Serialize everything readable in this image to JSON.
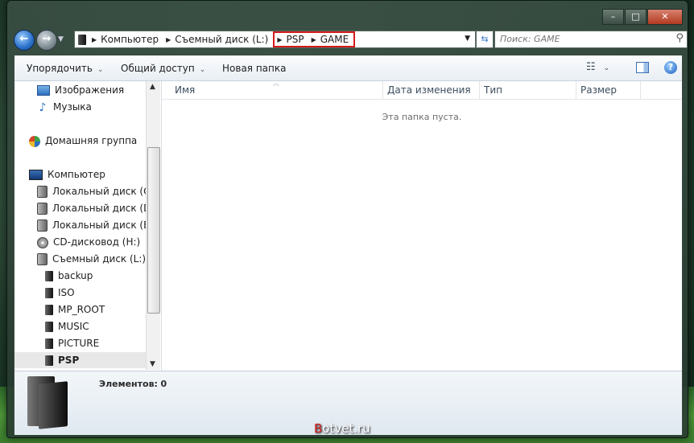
{
  "window": {
    "minimize": "–",
    "maximize": "□",
    "close": "✕"
  },
  "address": {
    "segments": [
      "Компьютер",
      "Съемный диск (L:)"
    ],
    "highlighted": [
      "PSP",
      "GAME"
    ]
  },
  "search": {
    "placeholder": "Поиск: GAME"
  },
  "toolbar": {
    "organize": "Упорядочить",
    "share": "Общий доступ",
    "new_folder": "Новая папка"
  },
  "nav": {
    "images": "Изображения",
    "music": "Музыка",
    "homegroup": "Домашняя группа",
    "computer": "Компьютер",
    "drive_c": "Локальный диск (C:",
    "drive_d": "Локальный диск (D:",
    "drive_e": "Локальный диск (E:",
    "drive_h": "CD-дисковод (H:)",
    "drive_l": "Съемный диск (L:)",
    "folders": [
      "backup",
      "ISO",
      "MP_ROOT",
      "MUSIC",
      "PICTURE",
      "PSP"
    ]
  },
  "columns": {
    "name": "Имя",
    "date": "Дата изменения",
    "type": "Тип",
    "size": "Размер"
  },
  "empty_text": "Эта папка пуста.",
  "details": {
    "label": "Элементов:",
    "count": "0"
  },
  "watermark": {
    "first": "B",
    "rest": "otvet.ru"
  }
}
